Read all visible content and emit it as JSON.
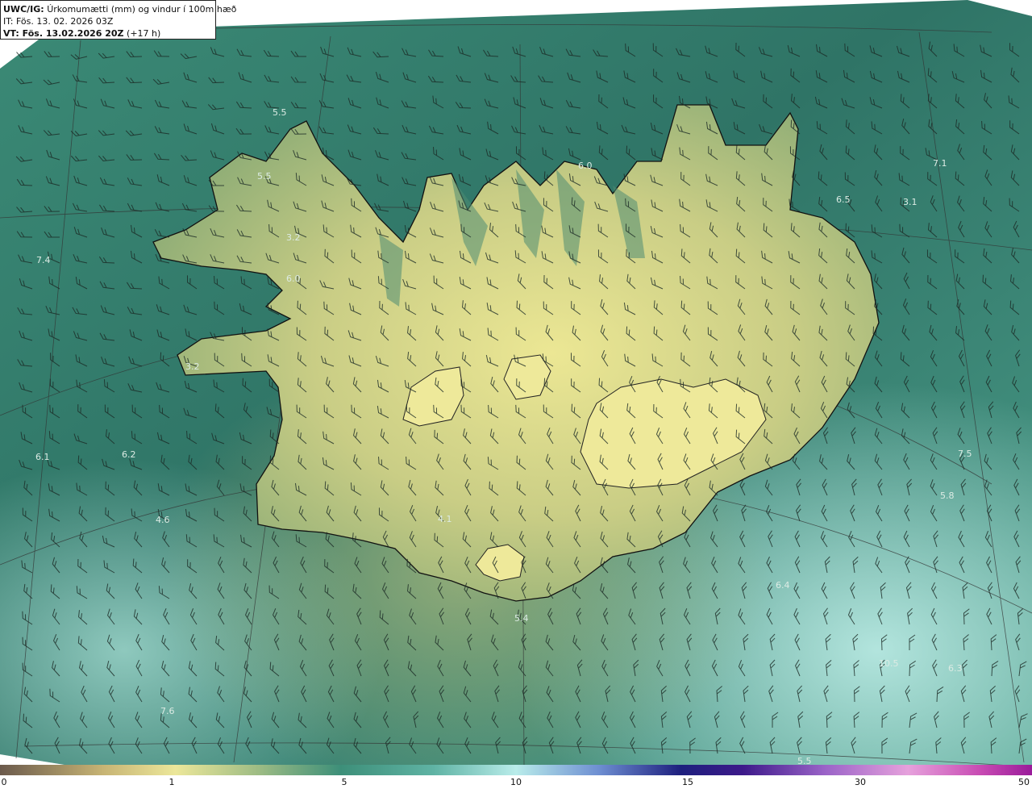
{
  "info": {
    "model": "UWC/IG:",
    "title": "Úrkomumætti (mm) og vindur í 100m hæð",
    "it_label": "IT:",
    "it_value": "Fös. 13. 02. 2026 03Z",
    "vt_label": "VT: Fös. 13.02.2026 20Z",
    "vt_lead": "(+17 h)"
  },
  "colorbar": {
    "tick_labels": [
      "0",
      "1",
      "5",
      "10",
      "15",
      "30",
      "50"
    ]
  },
  "map_labels": [
    "5.5",
    "5.5",
    "3.2",
    "6.0",
    "6.0",
    "6.5",
    "7.1",
    "3.1",
    "7.4",
    "3.2",
    "6.1",
    "6.2",
    "4.6",
    "4.1",
    "7.5",
    "5.8",
    "5.4",
    "6.4",
    "7.6",
    "6.3",
    "10.5",
    "5.5"
  ],
  "colors": {
    "ocean_dark": "#2f7264",
    "ocean_mid": "#3f8c78",
    "ocean_light": "#8fd4c8",
    "land_high": "#e8e592",
    "land_mid": "#b7c07e",
    "coast_line": "#111111"
  },
  "icons": [
    "wind-barb-icon"
  ]
}
